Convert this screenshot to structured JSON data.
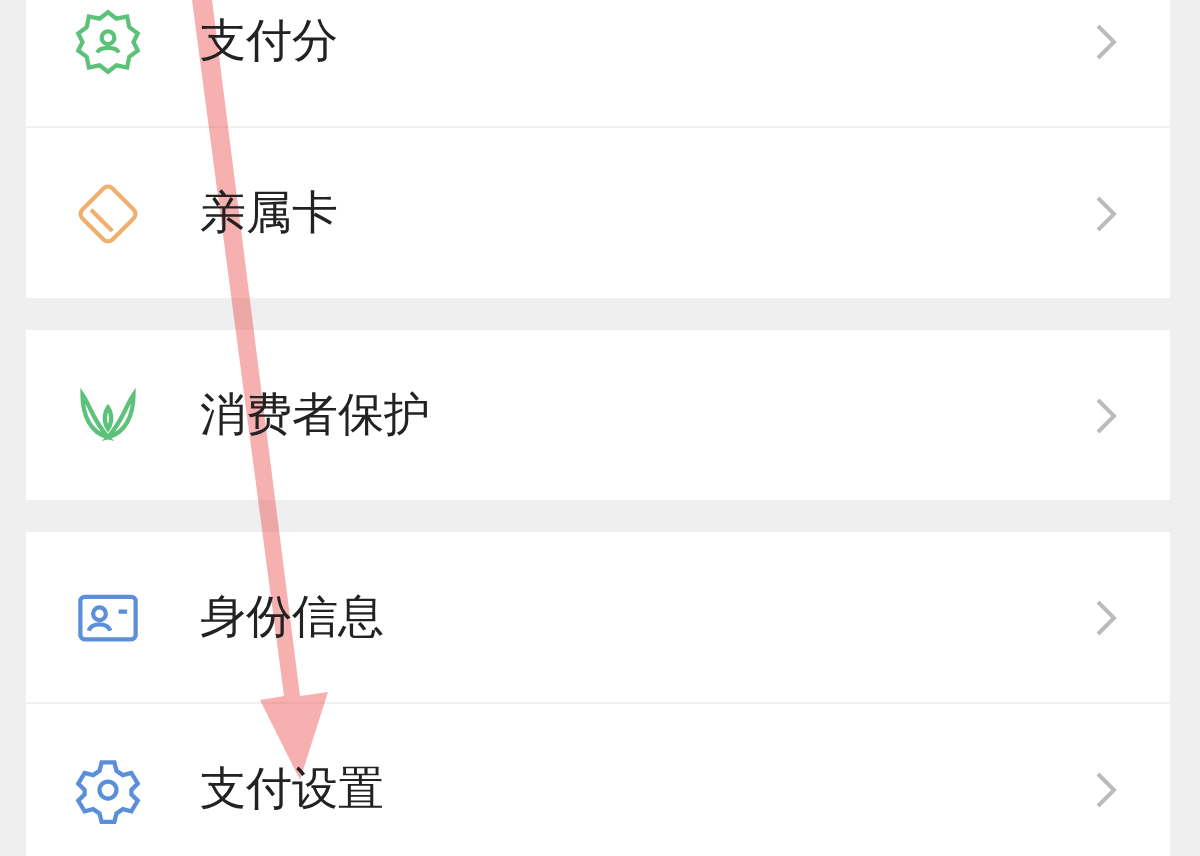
{
  "groups": [
    {
      "items": [
        {
          "label": "支付分",
          "kind": "score"
        },
        {
          "label": "亲属卡",
          "kind": "card"
        }
      ]
    },
    {
      "items": [
        {
          "label": "消费者保护",
          "kind": "hands"
        }
      ]
    },
    {
      "items": [
        {
          "label": "身份信息",
          "kind": "id"
        },
        {
          "label": "支付设置",
          "kind": "gear"
        }
      ]
    }
  ]
}
